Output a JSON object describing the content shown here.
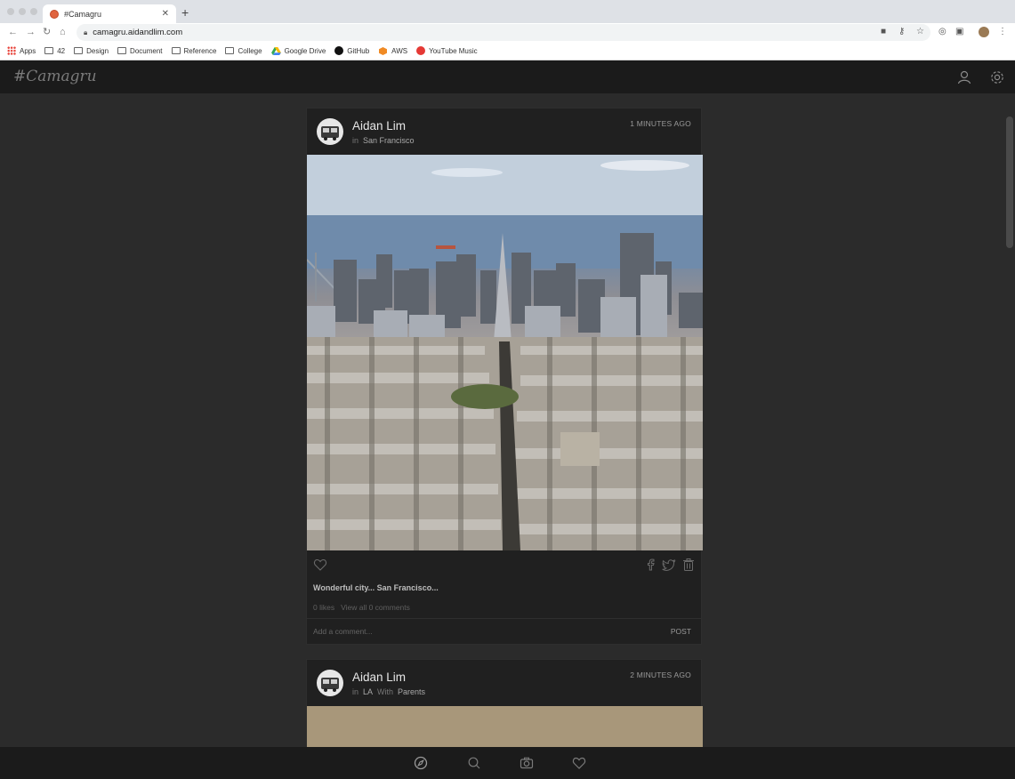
{
  "browser": {
    "tab_title": "#Camagru",
    "new_tab": "+",
    "url": "camagru.aidandlim.com",
    "bookmarks": [
      {
        "label": "Apps",
        "icon": "apps-grid-icon"
      },
      {
        "label": "42",
        "icon": "folder-icon"
      },
      {
        "label": "Design",
        "icon": "folder-icon"
      },
      {
        "label": "Document",
        "icon": "folder-icon"
      },
      {
        "label": "Reference",
        "icon": "folder-icon"
      },
      {
        "label": "College",
        "icon": "folder-icon"
      },
      {
        "label": "Google Drive",
        "icon": "google-drive-icon"
      },
      {
        "label": "GitHub",
        "icon": "github-icon"
      },
      {
        "label": "AWS",
        "icon": "aws-icon"
      },
      {
        "label": "YouTube Music",
        "icon": "youtube-music-icon"
      }
    ]
  },
  "app": {
    "logo": "#Camagru"
  },
  "posts": [
    {
      "author": "Aidan Lim",
      "location_prefix": "in",
      "location": "San Francisco",
      "time_ago": "1 MINUTES AGO",
      "caption": "Wonderful city... San Francisco...",
      "likes": "0 likes",
      "comments_link": "View all 0 comments",
      "comment_placeholder": "Add a comment...",
      "post_button": "POST"
    },
    {
      "author": "Aidan Lim",
      "location_prefix": "in",
      "location": "LA",
      "with_prefix": "With",
      "with": "Parents",
      "time_ago": "2 MINUTES AGO"
    }
  ],
  "colors": {
    "background": "#2b2b2b",
    "card": "#202020",
    "header": "#1b1b1b"
  }
}
